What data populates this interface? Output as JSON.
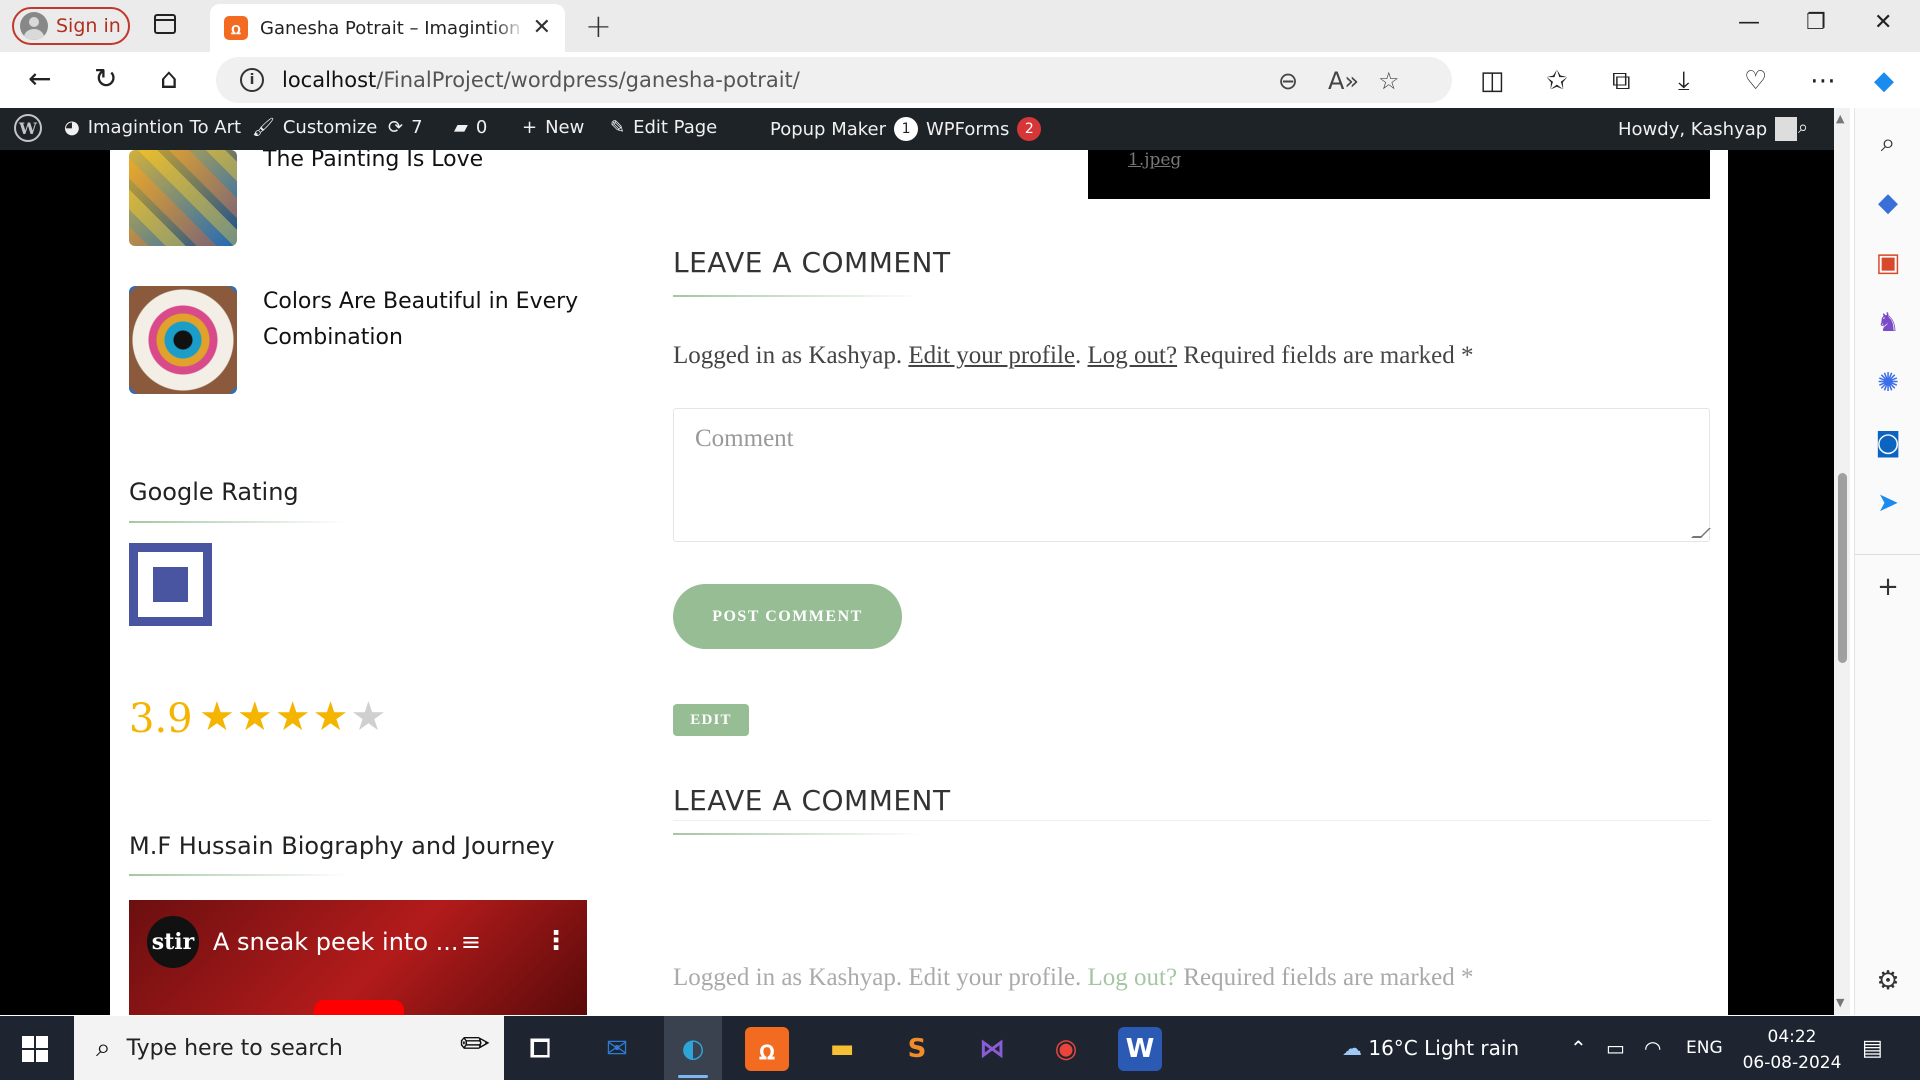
{
  "browser": {
    "sign_in_label": "Sign in",
    "tab_title": "Ganesha Potrait – Imagintion To Art",
    "url_host": "localhost",
    "url_path": "/FinalProject/wordpress/ganesha-potrait/"
  },
  "admin_bar": {
    "site_name": "Imagintion To Art",
    "customize": "Customize",
    "updates_count": "7",
    "comments_count": "0",
    "new_label": "New",
    "edit_page": "Edit Page",
    "popup_maker": "Popup Maker",
    "popup_maker_count": "1",
    "wpforms": "WPForms",
    "wpforms_count": "2",
    "howdy": "Howdy, Kashyap"
  },
  "sidebar": {
    "posts": [
      {
        "title": "The Painting Is Love"
      },
      {
        "title_line1": "Colors Are Beautiful in Every",
        "title_line2": "Combination"
      }
    ],
    "google_rating_heading": "Google Rating",
    "rating_value": "3.9",
    "rating_stars_filled": 4,
    "rating_stars_total": 5,
    "video_heading": "M.F Hussain Biography and Journey",
    "video_channel": "stir",
    "video_title": "A sneak peek into ..."
  },
  "main": {
    "image_caption": "1.jpeg",
    "comment_heading": "LEAVE A COMMENT",
    "logged_in_prefix": "Logged in as Kashyap. ",
    "edit_profile_link": "Edit your profile",
    "separator": ". ",
    "logout_link": "Log out?",
    "required_text": " Required fields are marked *",
    "comment_placeholder": "Comment",
    "post_comment_label": "POST COMMENT",
    "edit_label": "EDIT",
    "comment_heading_2": "LEAVE A COMMENT"
  },
  "taskbar": {
    "search_placeholder": "Type here to search",
    "weather": "16°C  Light rain",
    "language": "ENG",
    "time": "04:22",
    "date": "06-08-2024"
  },
  "colors": {
    "accent_green": "#96bd94",
    "rating_gold": "#f4b400",
    "admin_bar": "#1d2327",
    "badge_red": "#d63638"
  }
}
